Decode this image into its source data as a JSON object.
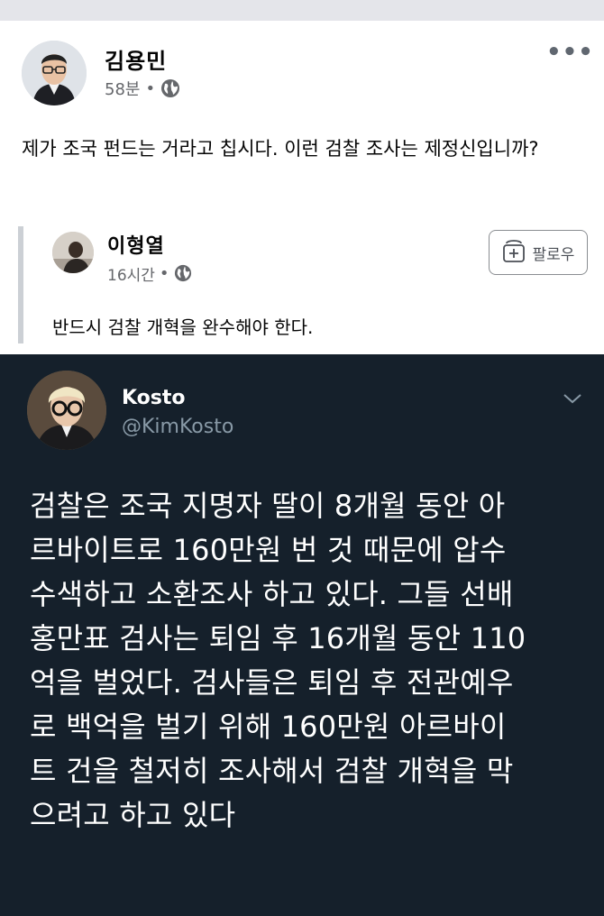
{
  "post": {
    "author": "김용민",
    "time": "58분",
    "separator": "•",
    "text": "제가 조국 펀드는 거라고 칩시다. 이런 검찰 조사는 제정신입니까?",
    "more_label": "•••"
  },
  "shared_post": {
    "author": "이형열",
    "time": "16시간",
    "separator": "•",
    "follow_label": "팔로우",
    "text": "반드시 검찰 개혁을 완수해야 한다."
  },
  "tweet": {
    "name": "Kosto",
    "handle": "@KimKosto",
    "text": "검찰은 조국 지명자 딸이 8개월 동안 아\n르바이트로 160만원 번 것 때문에 압수\n수색하고 소환조사 하고 있다. 그들 선배\n홍만표 검사는 퇴임 후 16개월 동안 110\n억을 벌었다. 검사들은 퇴임 후 전관예우\n로 백억을 벌기 위해  160만원 아르바이\n트 건을 철저히 조사해서 검찰 개혁을 막\n으려고 하고 있다"
  },
  "colors": {
    "tweet_background": "#15202b",
    "secondary_text": "#65676b",
    "tweet_handle": "#8899a6"
  },
  "icons": {
    "audience": "globe-icon",
    "follow": "follow-add-icon",
    "tweet_menu": "chevron-down-icon"
  }
}
